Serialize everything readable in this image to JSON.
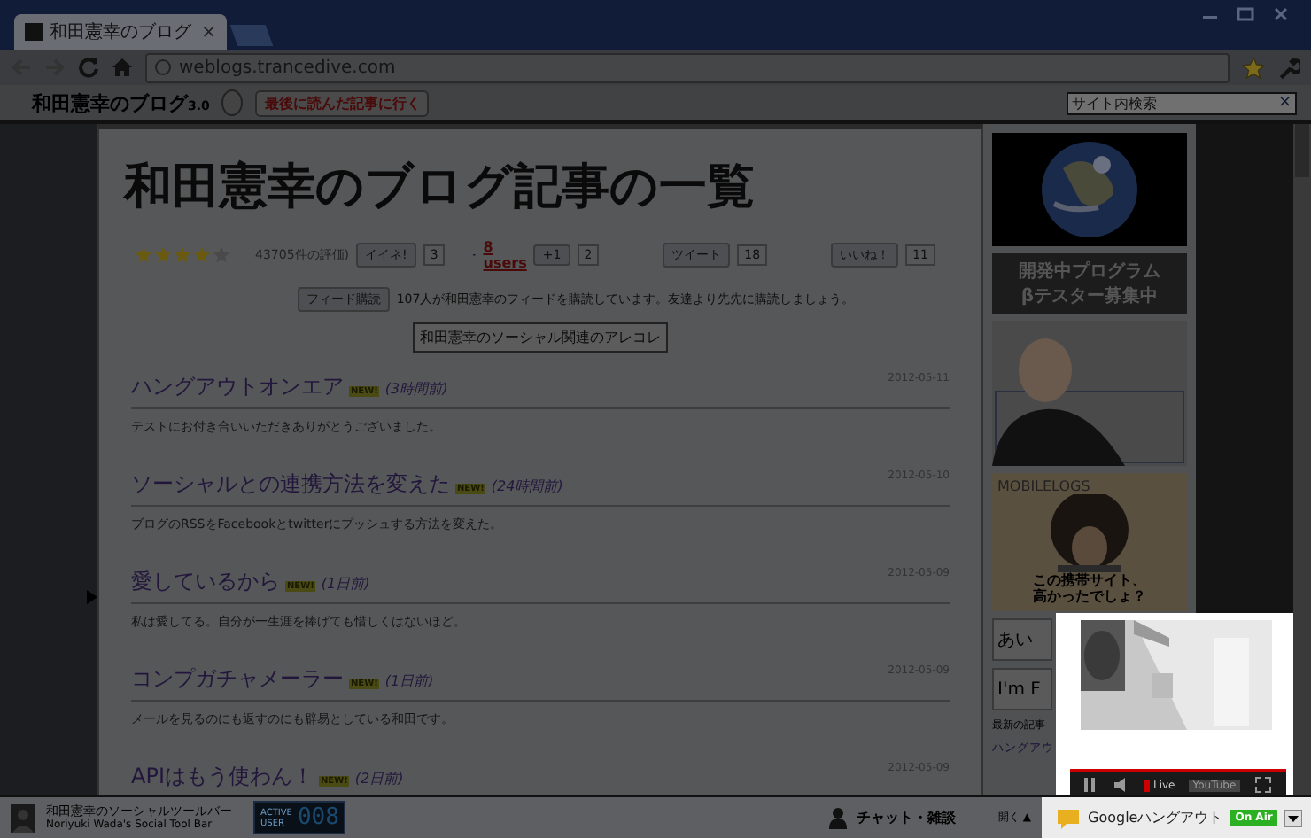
{
  "window": {
    "tab_title": "和田憲幸のブログ",
    "tab_close": "×"
  },
  "toolbar": {
    "url": "weblogs.trancedive.com"
  },
  "site_header": {
    "title": "和田憲幸のブログ",
    "version": "3.0",
    "last_read_button": "最後に読んだ記事に行く",
    "search": {
      "placeholder": "サイト内検索"
    },
    "clear": "×"
  },
  "page": {
    "heading": "和田憲幸のブログ記事の一覧",
    "rating": {
      "stars": 4,
      "count": "43705件の評価)"
    },
    "social": [
      {
        "kind": "mixi",
        "label": "イイネ!",
        "count": "3"
      },
      {
        "kind": "hatena",
        "label": "8 users"
      },
      {
        "kind": "plusone",
        "label": "+1",
        "count": "2"
      },
      {
        "kind": "tweet",
        "label": "ツイート",
        "count": "18"
      },
      {
        "kind": "like",
        "label": "いいね！",
        "count": "11"
      }
    ],
    "feed": {
      "button": "フィード購読",
      "text": "107人が和田憲幸のフィードを購読しています。友達より先先に購読しましょう。"
    },
    "social_button": "和田憲幸のソーシャル関連のアレコレ",
    "posts": [
      {
        "title": "ハングアウトオンエア",
        "badge": "NEW!",
        "age": "(3時間前)",
        "date": "2012-05-11",
        "excerpt": "テストにお付き合いいただきありがとうございました。"
      },
      {
        "title": "ソーシャルとの連携方法を変えた",
        "badge": "NEW!",
        "age": "(24時間前)",
        "date": "2012-05-10",
        "excerpt": "ブログのRSSをFacebookとtwitterにプッシュする方法を変えた。"
      },
      {
        "title": "愛しているから",
        "badge": "NEW!",
        "age": "(1日前)",
        "date": "2012-05-09",
        "excerpt": "私は愛してる。自分が一生涯を捧げても惜しくはないほど。"
      },
      {
        "title": "コンプガチャメーラー",
        "badge": "NEW!",
        "age": "(1日前)",
        "date": "2012-05-09",
        "excerpt": "メールを見るのにも返すのにも辟易としている和田です。"
      },
      {
        "title": "APIはもう使わん！",
        "badge": "NEW!",
        "age": "(2日前)",
        "date": "2012-05-09"
      }
    ]
  },
  "sidebar": {
    "beta_banner": [
      "開発中プログラム",
      "βテスター募集中"
    ],
    "ad_brand": "MOBILELOGS",
    "ad_text": [
      "この携帯サイト、",
      "高かったでしょ？"
    ],
    "button_1": "あい",
    "button_2": "I'm F",
    "recent_heading": "最新の記事",
    "recent_link": "ハングアウ"
  },
  "bottom_bar": {
    "title": "和田憲幸のソーシャルツールバー",
    "subtitle": "Noriyuki Wada's Social Tool Bar",
    "counter_label": [
      "ACTIVE",
      "USER"
    ],
    "counter": "008",
    "chat": "チャット・雑談",
    "open": "開く ▲",
    "hangout": "Googleハングアウト",
    "on_air": "On Air"
  },
  "video": {
    "live": "Live",
    "brand": "YouTube",
    "playing": true
  }
}
